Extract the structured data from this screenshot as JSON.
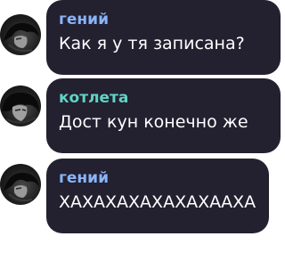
{
  "messages": [
    {
      "author": "гений",
      "author_color": "#8ab4f8",
      "text": "Как я у тя записана?",
      "avatar_icon": "dark-hair-anime-avatar"
    },
    {
      "author": "котлета",
      "author_color": "#5fd3c4",
      "text": "Дост кун конечно же",
      "avatar_icon": "dark-hair-anime-avatar"
    },
    {
      "author": "гений",
      "author_color": "#8ab4f8",
      "text": "ХАХАХАХАХАХАХААХА",
      "avatar_icon": "dark-hair-anime-avatar"
    }
  ]
}
